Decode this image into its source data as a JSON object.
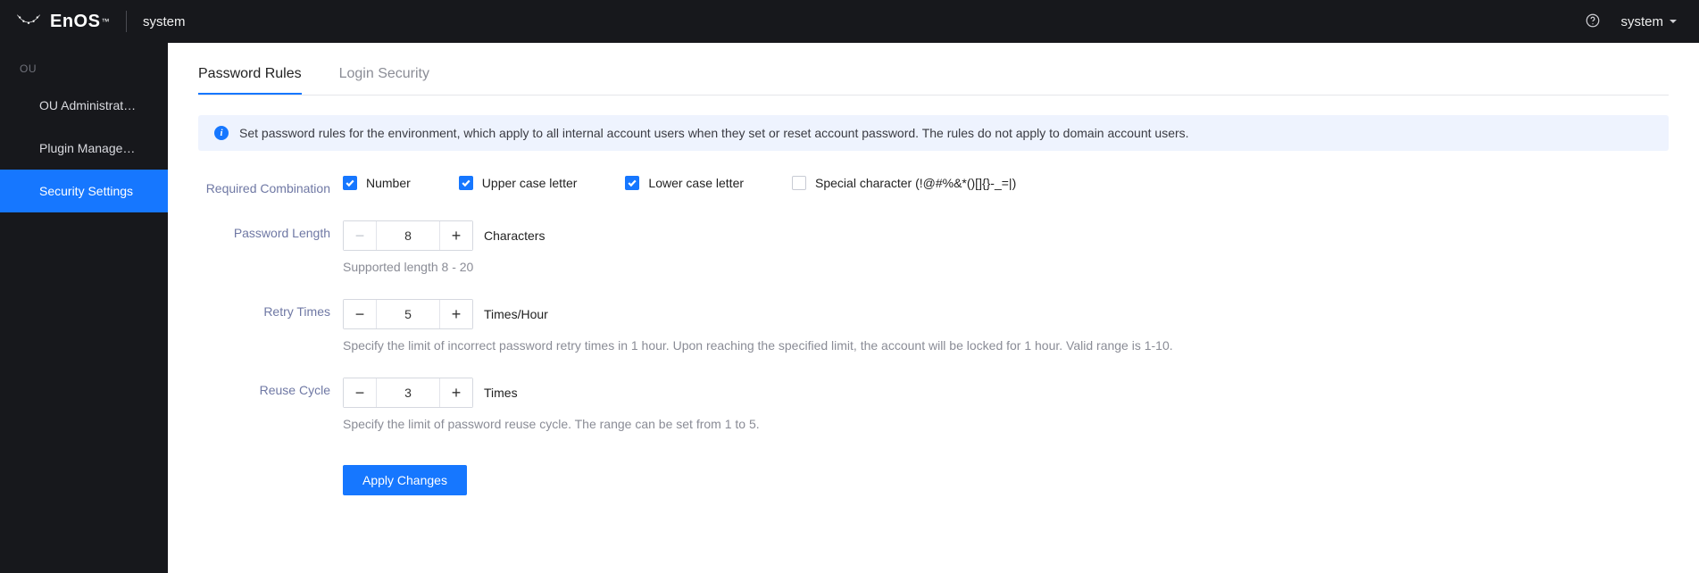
{
  "header": {
    "brand": "EnOS",
    "tm": "™",
    "context": "system",
    "user_label": "system"
  },
  "sidebar": {
    "section": "OU",
    "items": [
      {
        "label": "OU Administrat…"
      },
      {
        "label": "Plugin Manage…"
      },
      {
        "label": "Security Settings"
      }
    ],
    "active_index": 2
  },
  "tabs": [
    {
      "label": "Password Rules",
      "active": true
    },
    {
      "label": "Login Security",
      "active": false
    }
  ],
  "banner": "Set password rules for the environment, which apply to all internal account users when they set or reset account password. The rules do not apply to domain account users.",
  "form": {
    "required_combination": {
      "label": "Required Combination",
      "options": {
        "number": {
          "label": "Number",
          "checked": true
        },
        "upper": {
          "label": "Upper case letter",
          "checked": true
        },
        "lower": {
          "label": "Lower case letter",
          "checked": true
        },
        "special": {
          "label": "Special character (!@#%&*()[]{}-_=|)",
          "checked": false
        }
      }
    },
    "password_length": {
      "label": "Password Length",
      "value": "8",
      "unit": "Characters",
      "hint": "Supported length 8 - 20",
      "minus_disabled": true
    },
    "retry_times": {
      "label": "Retry Times",
      "value": "5",
      "unit": "Times/Hour",
      "hint": "Specify the limit of incorrect password retry times in 1 hour. Upon reaching the specified limit, the account will be locked for 1 hour. Valid range is 1-10."
    },
    "reuse_cycle": {
      "label": "Reuse Cycle",
      "value": "3",
      "unit": "Times",
      "hint": "Specify the limit of password reuse cycle. The range can be set from 1 to 5."
    },
    "apply_label": "Apply Changes",
    "minus": "−",
    "plus": "+"
  }
}
